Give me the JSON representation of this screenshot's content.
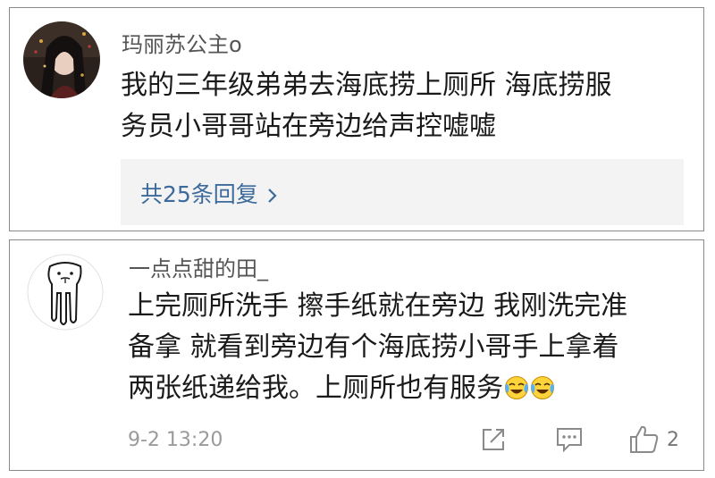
{
  "comments": [
    {
      "username": "玛丽苏公主o",
      "text_lines": [
        "我的三年级弟弟去海底捞上厕所 海底捞服",
        "务员小哥哥站在旁边给声控嘘嘘"
      ],
      "replies_label": "共25条回复",
      "avatar_icon": "avatar-photo-icon"
    },
    {
      "username": "一点点甜的田_",
      "text_lines": [
        "上完厕所洗手 擦手纸就在旁边 我刚洗完准",
        "备拿 就看到旁边有个海底捞小哥手上拿着",
        "两张纸递给我。上厕所也有服务"
      ],
      "emoji": [
        "crying-laughing-emoji",
        "crying-laughing-emoji"
      ],
      "timestamp": "9-2 13:20",
      "like_count": "2",
      "avatar_icon": "cartoon-avatar-icon"
    }
  ],
  "colors": {
    "link": "#3c6a9c",
    "text": "#1a1a1a",
    "username": "#555555",
    "meta": "#9a9a9a",
    "reply_bg": "#f3f3f3"
  }
}
